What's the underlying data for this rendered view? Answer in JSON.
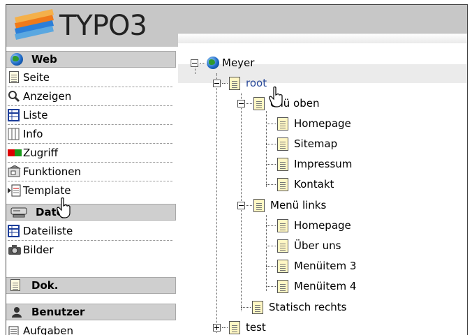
{
  "app": {
    "logo_text": "TYPO3"
  },
  "nav": {
    "sections": [
      {
        "label": "Web",
        "icon": "globe-icon"
      },
      {
        "label": "Datei",
        "icon": "drive-icon"
      },
      {
        "label": "Dok.",
        "icon": "document-icon"
      },
      {
        "label": "Benutzer",
        "icon": "user-icon"
      }
    ],
    "web_items": [
      "Seite",
      "Anzeigen",
      "Liste",
      "Info",
      "Zugriff",
      "Funktionen",
      "Template"
    ],
    "file_items": [
      "Dateiliste",
      "Bilder"
    ],
    "user_items": [
      "Aufgaben"
    ]
  },
  "tree": {
    "root_label": "Meyer",
    "nodes": [
      {
        "label": "root",
        "level": 1,
        "toggle": "minus",
        "selected": true
      },
      {
        "label": "enü oben",
        "level": 2,
        "toggle": "minus"
      },
      {
        "label": "Homepage",
        "level": 3
      },
      {
        "label": "Sitemap",
        "level": 3
      },
      {
        "label": "Impressum",
        "level": 3
      },
      {
        "label": "Kontakt",
        "level": 3
      },
      {
        "label": "Menü links",
        "level": 2,
        "toggle": "minus"
      },
      {
        "label": "Homepage",
        "level": 3
      },
      {
        "label": "Über uns",
        "level": 3
      },
      {
        "label": "Menüitem 3",
        "level": 3
      },
      {
        "label": "Menüitem 4",
        "level": 3
      },
      {
        "label": "Statisch rechts",
        "level": 2
      },
      {
        "label": "test",
        "level": 1,
        "toggle": "plus"
      }
    ]
  },
  "colors": {
    "topbar": "#c7c7c7",
    "section_bg": "#cfcfcf",
    "link": "#2a4a9a",
    "page_icon": "#fff7c4"
  }
}
